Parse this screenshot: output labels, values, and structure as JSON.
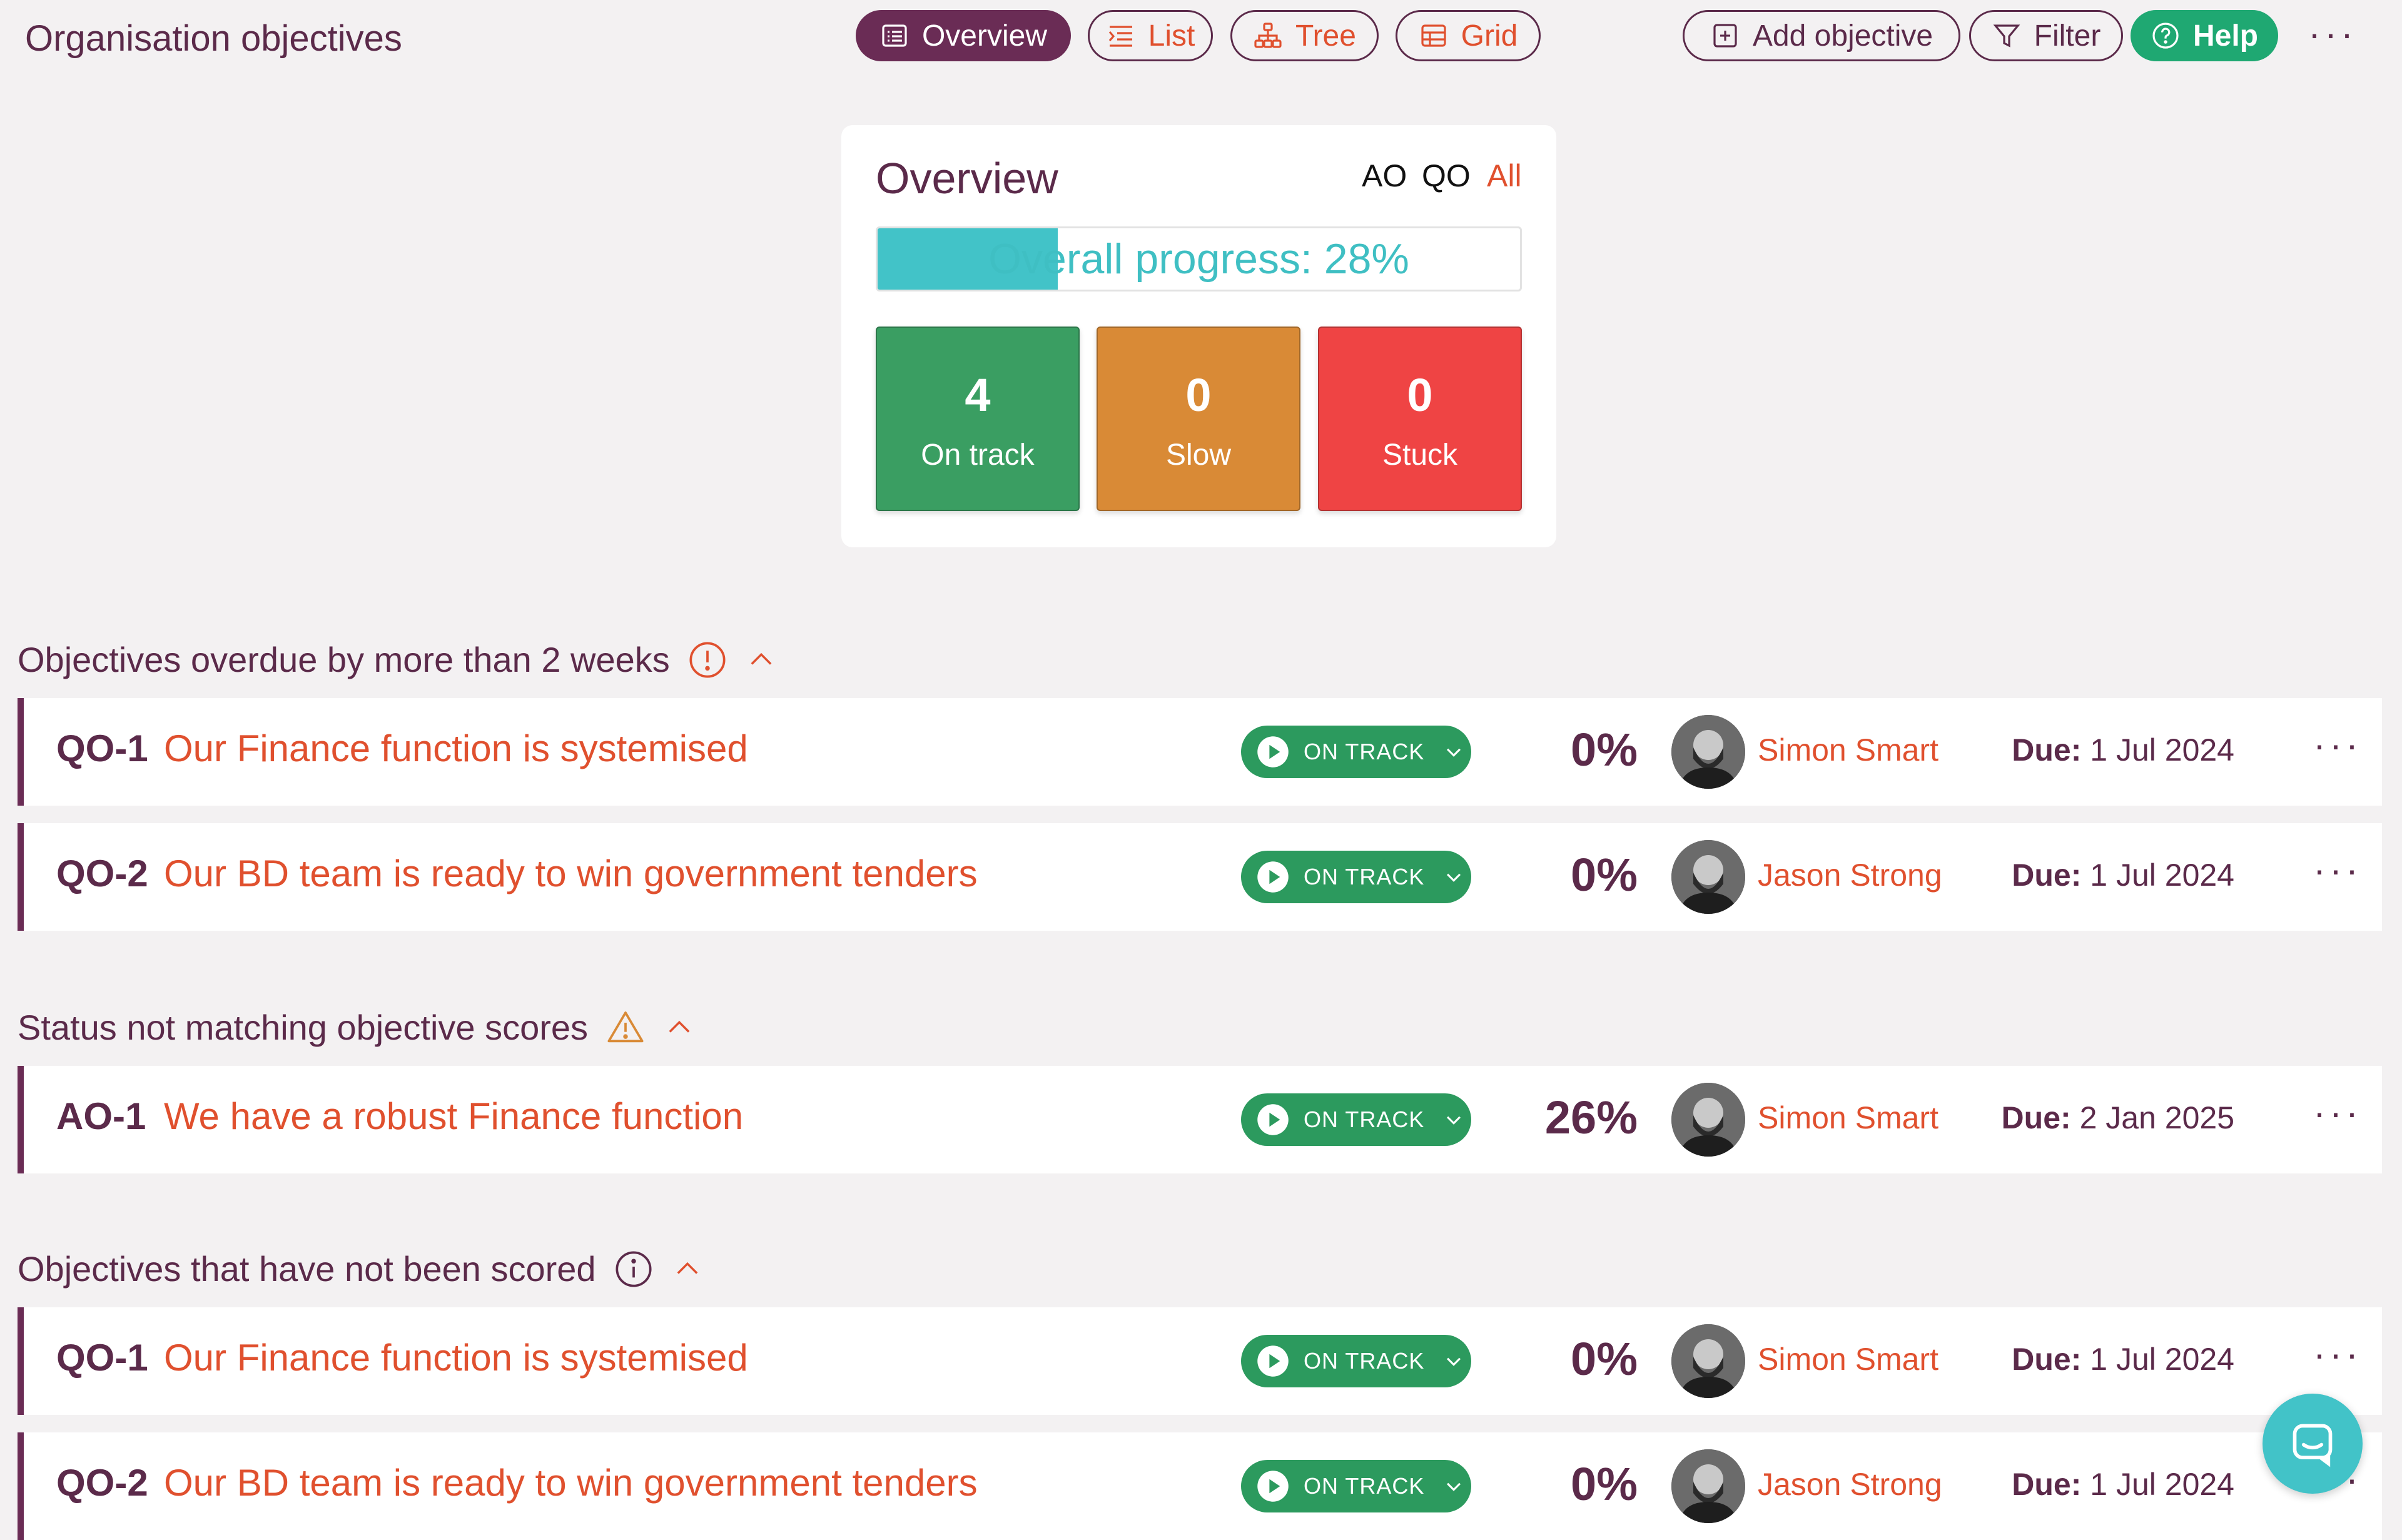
{
  "header": {
    "title": "Organisation objectives",
    "tabs": [
      {
        "label": "Overview",
        "icon": "overview-icon",
        "active": true
      },
      {
        "label": "List",
        "icon": "list-icon"
      },
      {
        "label": "Tree",
        "icon": "tree-icon"
      },
      {
        "label": "Grid",
        "icon": "grid-icon"
      }
    ],
    "add_label": "Add objective",
    "filter_label": "Filter",
    "help_label": "Help",
    "more": "···"
  },
  "overview": {
    "title": "Overview",
    "filters": [
      "AO",
      "QO",
      "All"
    ],
    "selected_filter": "All",
    "progress_label": "Overall progress: 28%",
    "progress_value": 0.28,
    "stats": [
      {
        "value": "4",
        "label": "On track",
        "color": "#3a9e62"
      },
      {
        "value": "0",
        "label": "Slow",
        "color": "#d98a36"
      },
      {
        "value": "0",
        "label": "Stuck",
        "color": "#ef4444"
      }
    ]
  },
  "sections": [
    {
      "heading": "Objectives overdue by more than 2 weeks",
      "icon": "alert-circle-icon",
      "rows": [
        {
          "code": "QO-1",
          "title": "Our Finance function is systemised",
          "status": "ON TRACK",
          "progress": "0%",
          "owner": "Simon Smart",
          "due_label": "Due:",
          "due": "1 Jul 2024"
        },
        {
          "code": "QO-2",
          "title": "Our BD team is ready to win government tenders",
          "status": "ON TRACK",
          "progress": "0%",
          "owner": "Jason Strong",
          "due_label": "Due:",
          "due": "1 Jul 2024"
        }
      ]
    },
    {
      "heading": "Status not matching objective scores",
      "icon": "warning-triangle-icon",
      "rows": [
        {
          "code": "AO-1",
          "title": "We have a robust Finance function",
          "status": "ON TRACK",
          "progress": "26%",
          "owner": "Simon Smart",
          "due_label": "Due:",
          "due": "2 Jan 2025"
        }
      ]
    },
    {
      "heading": "Objectives that have not been scored",
      "icon": "info-circle-icon",
      "rows": [
        {
          "code": "QO-1",
          "title": "Our Finance function is systemised",
          "status": "ON TRACK",
          "progress": "0%",
          "owner": "Simon Smart",
          "due_label": "Due:",
          "due": "1 Jul 2024"
        },
        {
          "code": "QO-2",
          "title": "Our BD team is ready to win government tenders",
          "status": "ON TRACK",
          "progress": "0%",
          "owner": "Jason Strong",
          "due_label": "Due:",
          "due": "1 Jul 2024"
        }
      ]
    }
  ],
  "colors": {
    "brand": "#5b2a4a",
    "accent": "#e0502e",
    "teal": "#42c3c8",
    "on_track": "#2c9a5e",
    "help": "#1fa872"
  }
}
